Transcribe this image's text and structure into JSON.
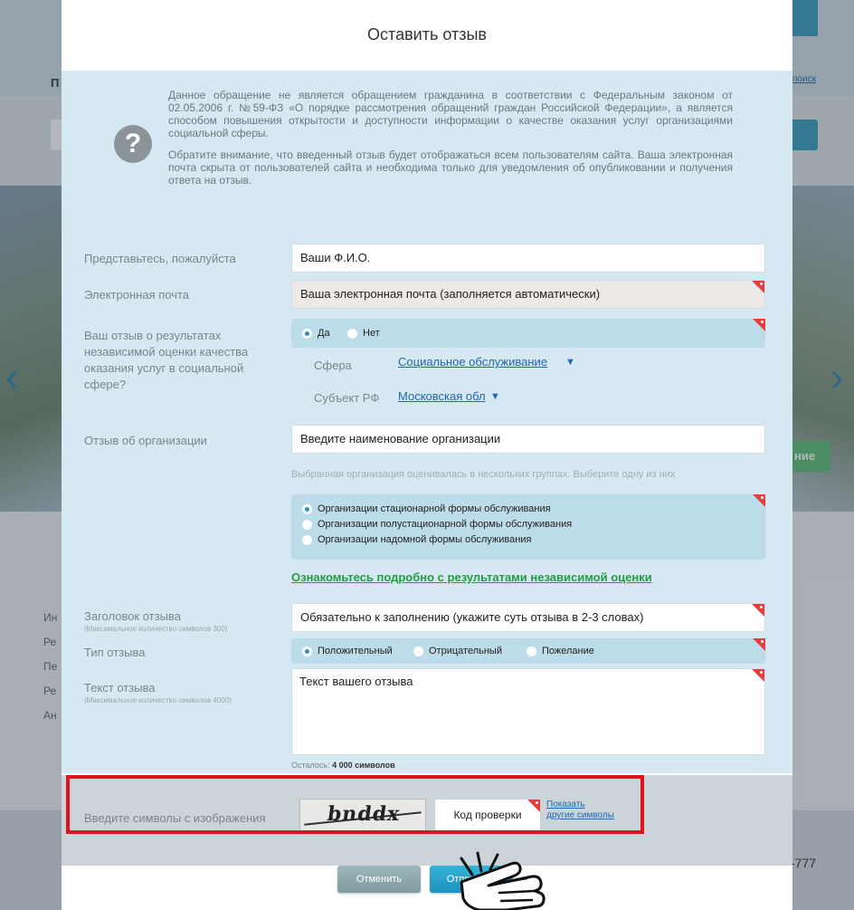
{
  "background": {
    "header_letter": "П",
    "search_link": "поиск",
    "green_badge": "ние",
    "side_links": [
      "Ин",
      "Ре",
      "Пе",
      "Ре",
      "Ан"
    ],
    "phone": "-777"
  },
  "modal": {
    "title": "Оставить отзыв",
    "notice": {
      "icon": "question-icon",
      "paragraph1": "Данное обращение не является обращением гражданина в соответствии с Федеральным законом от 02.05.2006 г. №59-ФЗ «О порядке рассмотрения обращений граждан Российской Федерации», а является способом повышения открытости и доступности информации о качестве оказания услуг организациями социальной сферы.",
      "paragraph2": "Обратите внимание, что введенный отзыв будет отображаться всем пользователям сайта. Ваша электронная почта скрыта от пользователей сайта и необходима только для уведомления об опубликовании и получения ответа на отзыв."
    },
    "form": {
      "name_label": "Представьтесь, пожалуйста",
      "name_value": "Ваши Ф.И.О.",
      "email_label": "Электронная почта",
      "email_value": "Ваша электронная почта (заполняется автоматически)",
      "independent_label": "Ваш отзыв о результатах независимой оценки качества оказания услуг в социальной сфере?",
      "yes": "Да",
      "no": "Нет",
      "yes_selected": true,
      "sphere_label": "Сфера",
      "sphere_value": "Социальное обслуживание",
      "region_label": "Субъект РФ",
      "region_value": "Московская обл",
      "org_label": "Отзыв об организации",
      "org_value": "Введите наименование организации",
      "groups_hint": "Выбранная организация оценивалась в нескольких группах. Выберите одну из них",
      "groups": [
        "Организации стационарной формы обслуживания",
        "Организации полустационарной формы обслуживания",
        "Организации надомной формы обслуживания"
      ],
      "groups_selected": 0,
      "results_link": "Ознакомьтесь подробно с результатами независимой оценки",
      "subject_label": "Заголовок отзыва",
      "subject_sub": "(Максимальное количество символов 300)",
      "subject_value": "Обязательно к заполнению  (укажите суть отзыва в 2-3 словах)",
      "type_label": "Тип отзыва",
      "types": [
        "Положительный",
        "Отрицательный",
        "Пожелание"
      ],
      "types_selected": 0,
      "text_label": "Текст отзыва",
      "text_sub": "(Максимальное количество символов 4000)",
      "text_value": "Текст вашего отзыва",
      "remain_prefix": "Осталось:",
      "remain_value": "4 000 символов"
    },
    "captcha": {
      "label": "Введите символы с изображения",
      "image_text": "bnddx",
      "input_placeholder": "Код проверки",
      "refresh_line1": "Показать",
      "refresh_line2": "другие символы"
    },
    "buttons": {
      "cancel": "Отменить",
      "send": "Отправить"
    }
  },
  "colors": {
    "accent_blue": "#1d93bd",
    "form_bg": "#d6e9f2",
    "required_marker": "#e63c3c",
    "highlight_box": "#e0131c",
    "link_green": "#1f9e3e",
    "link_blue": "#2264b5"
  }
}
